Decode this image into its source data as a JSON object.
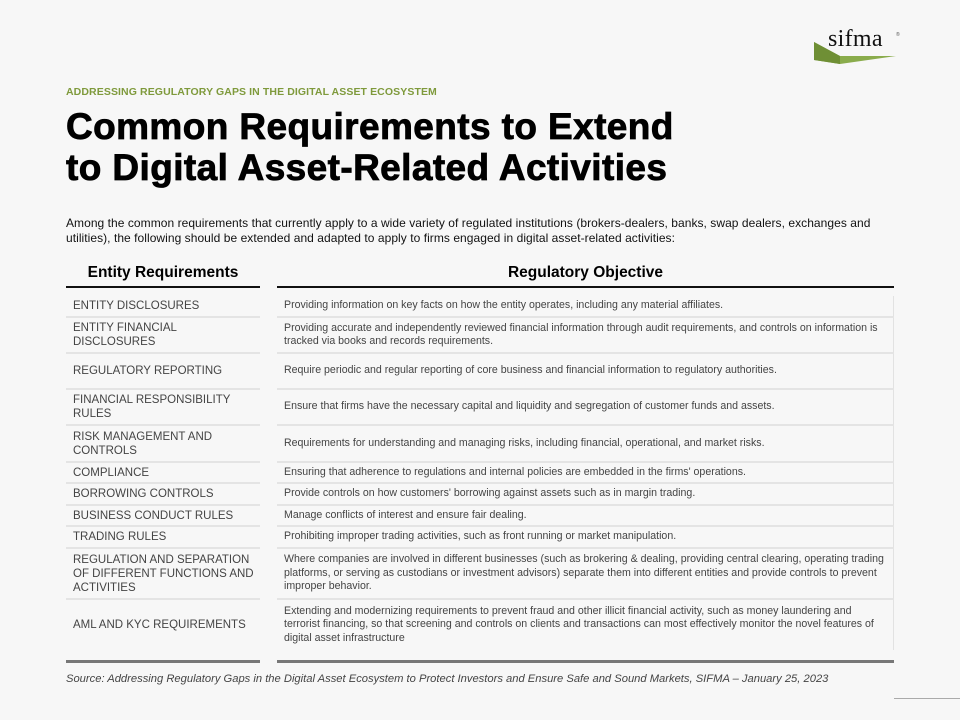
{
  "logo": {
    "text": "sifma",
    "reg": "®",
    "accent_color": "#8aac4c"
  },
  "kicker": "ADDRESSING REGULATORY GAPS IN THE DIGITAL ASSET ECOSYSTEM",
  "title_line1": "Common Requirements to Extend",
  "title_line2": "to Digital Asset-Related Activities",
  "intro": "Among the common requirements that currently apply to a wide variety of regulated institutions (brokers-dealers,  banks, swap dealers, exchanges and utilities), the following should be extended and adapted to apply to firms engaged in digital asset-related activities:",
  "table": {
    "headers": [
      "Entity Requirements",
      "Regulatory Objective"
    ],
    "rows": [
      {
        "requirement": "ENTITY DISCLOSURES",
        "objective": "Providing information on key facts on how the entity operates, including any material affiliates."
      },
      {
        "requirement": "ENTITY FINANCIAL DISCLOSURES",
        "objective": "Providing accurate and independently reviewed financial information through audit requirements, and controls on information is tracked via books and records requirements."
      },
      {
        "requirement": "REGULATORY REPORTING",
        "objective": "Require periodic and regular reporting of core business and financial information to regulatory authorities."
      },
      {
        "requirement": "FINANCIAL RESPONSIBILITY RULES",
        "objective": "Ensure that firms have the necessary capital and liquidity and segregation of customer funds and assets."
      },
      {
        "requirement": "RISK MANAGEMENT  AND CONTROLS",
        "objective": "Requirements for understanding and managing risks, including financial, operational, and market risks."
      },
      {
        "requirement": "COMPLIANCE",
        "objective": "Ensuring that adherence to regulations and internal policies are embedded in the firms' operations."
      },
      {
        "requirement": "BORROWING CONTROLS",
        "objective": "Provide controls on how customers' borrowing against assets such as in margin trading."
      },
      {
        "requirement": "BUSINESS CONDUCT RULES",
        "objective": "Manage conflicts of interest and ensure fair dealing."
      },
      {
        "requirement": "TRADING RULES",
        "objective": "Prohibiting improper trading activities, such as front running or market manipulation."
      },
      {
        "requirement": "REGULATION AND SEPARATION  OF DIFFERENT FUNCTIONS AND ACTIVITIES",
        "objective": "Where companies are involved in different businesses (such as brokering & dealing, providing central clearing, operating trading platforms, or serving as custodians or investment advisors) separate them into different entities and provide controls to prevent improper behavior."
      },
      {
        "requirement": "AML AND KYC REQUIREMENTS",
        "objective": "Extending and modernizing requirements to prevent fraud and other illicit financial activity,  such as money laundering and terrorist financing, so that screening and controls on clients and transactions can most effectively monitor the novel features of digital asset infrastructure"
      }
    ]
  },
  "source": "Source: Addressing Regulatory Gaps in the Digital Asset Ecosystem to Protect Investors and Ensure Safe and Sound Markets, SIFMA – January 25, 2023"
}
